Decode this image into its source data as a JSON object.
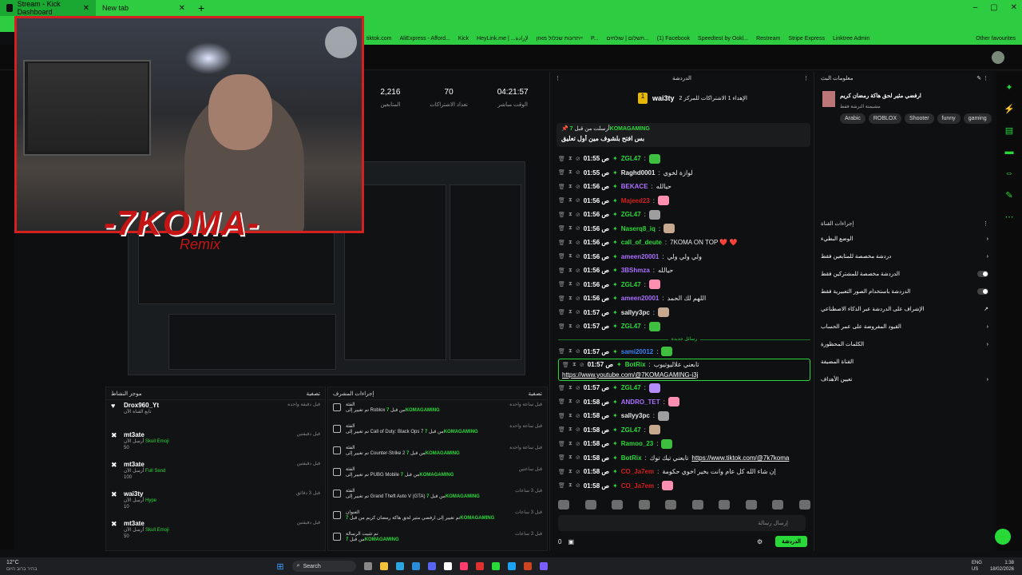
{
  "browser": {
    "tabs": [
      {
        "label": "Stream - Kick Dashboard",
        "active": true
      },
      {
        "label": "New tab",
        "active": false
      }
    ],
    "new_tab": "+",
    "controls": [
      "‒",
      "▢",
      "✕"
    ],
    "bookmarks": [
      "tiktok.com",
      "AliExpress - Afford...",
      "Kick",
      "HeyLink.me | ...لإرادة",
      "ייתרונות שכלול מאזן",
      "P...",
      "תשלום | שולחים...",
      "(1) Facebook",
      "Speedtest by Ookl...",
      "Restream",
      "Stripe Express",
      "Linktree Admin"
    ],
    "other_favourites": "Other favourites"
  },
  "brand": {
    "name": "7KOMA",
    "sub": "Remix"
  },
  "stats": [
    {
      "value": "2,216",
      "label": "المتابعين"
    },
    {
      "value": "70",
      "label": "تعداد الاشتراكات"
    },
    {
      "value": "04:21:57",
      "label": "الوقت مباشر"
    }
  ],
  "activity": {
    "title": "موجز النشاط",
    "filter": "تصفية",
    "events": [
      {
        "icon": "♥",
        "user": "Drox960_Yt",
        "action": "تابع القناة الآن",
        "amount": "",
        "time": "قبل دقيقة واحدة"
      },
      {
        "icon": "✖",
        "user": "mt3ate",
        "action": "Skull Emoji",
        "prefix": "أرسل الآن",
        "amount": "50",
        "time": "قبل دقيقتين"
      },
      {
        "icon": "✖",
        "user": "mt3ate",
        "action": "Full Send",
        "prefix": "أرسل الآن",
        "amount": "100",
        "time": "قبل دقيقتين"
      },
      {
        "icon": "✖",
        "user": "wai3ty",
        "action": "Hype",
        "prefix": "أرسل الآن",
        "amount": "10",
        "time": "قبل 3 دقائق"
      },
      {
        "icon": "✖",
        "user": "mt3ate",
        "action": "Skull Emoji",
        "prefix": "أرسل الآن",
        "amount": "50",
        "time": "قبل دقيقتين"
      },
      {
        "icon": "✖",
        "user": "mt3ate",
        "action": "",
        "amount": "",
        "time": ""
      }
    ]
  },
  "mod_actions": {
    "title": "إجراءات المشرف",
    "filter": "تصفية",
    "items": [
      {
        "type": "الفئة",
        "text": "تم تغيير إلى Roblox من قبل",
        "user": "7KOMAGAMING",
        "time": "قبل ساعة واحدة"
      },
      {
        "type": "الفئة",
        "text": "تم تغيير إلى Call of Duty: Black Ops 7 من قبل",
        "user": "7KOMAGAMING",
        "time": "قبل ساعة واحدة"
      },
      {
        "type": "الفئة",
        "text": "تم تغيير إلى Counter-Strike 2 من قبل",
        "user": "7KOMAGAMING",
        "time": "قبل ساعة واحدة"
      },
      {
        "type": "الفئة",
        "text": "تم تغيير إلى PUBG Mobile من قبل",
        "user": "7KOMAGAMING",
        "time": "قبل ساعتين"
      },
      {
        "type": "الفئة",
        "text": "تم تغيير إلى Grand Theft Auto V (GTA) من قبل",
        "user": "7KOMAGAMING",
        "time": "قبل 3 ساعات"
      },
      {
        "type": "العنوان",
        "text": "تم تغيير إلى ارفضي مثير لحق هاكة رمضان كريم من قبل",
        "user": "7KOMAGAMING",
        "time": "قبل 3 ساعات"
      },
      {
        "type": "تم تثبيت الرسالة",
        "text": "من قبل",
        "user": "7KOMAGAMING",
        "time": "قبل 3 ساعات"
      }
    ]
  },
  "chat": {
    "title": "الدردشة",
    "leader": {
      "rank": "1",
      "name": "wai3ty",
      "note": "الإهداء 1 الاشتراكات للمركز 2"
    },
    "pinned": {
      "by": "7KOMAGAMING",
      "label": "أرسلت من قبل",
      "message": "بس افتح بلشوف مين أول تعليق"
    },
    "separator": "رسائل جديدة",
    "messages": [
      {
        "time": "01:55 ص",
        "user": "ZGL47",
        "color": "#29d93a",
        "text": ""
      },
      {
        "time": "01:55 ص",
        "user": "Raghd0001",
        "color": "#e8e8e8",
        "text": "لوازة لخوي"
      },
      {
        "time": "01:56 ص",
        "user": "BEKACE",
        "color": "#a970ff",
        "text": "حيالله"
      },
      {
        "time": "01:56 ص",
        "user": "Majeed23",
        "color": "#d61f1f",
        "text": ""
      },
      {
        "time": "01:56 ص",
        "user": "ZGL47",
        "color": "#29d93a",
        "text": ""
      },
      {
        "time": "01:56 ص",
        "user": "Naserq8_iq",
        "color": "#29d93a",
        "text": ""
      },
      {
        "time": "01:56 ص",
        "user": "call_of_deute",
        "color": "#29d93a",
        "text": "7KOMA ON TOP ❤️ ❤️"
      },
      {
        "time": "01:56 ص",
        "user": "ameen20001",
        "color": "#a970ff",
        "text": "ولي ولي ولي"
      },
      {
        "time": "01:56 ص",
        "user": "3BShmza",
        "color": "#a970ff",
        "text": "حيالله"
      },
      {
        "time": "01:56 ص",
        "user": "ZGL47",
        "color": "#29d93a",
        "text": ""
      },
      {
        "time": "01:56 ص",
        "user": "ameen20001",
        "color": "#a970ff",
        "text": "اللهم لك الحمد"
      },
      {
        "time": "01:57 ص",
        "user": "sallyy3pc",
        "color": "#e8e8e8",
        "text": ""
      },
      {
        "time": "01:57 ص",
        "user": "ZGL47",
        "color": "#29d93a",
        "text": ""
      }
    ],
    "messages_after": [
      {
        "time": "01:57 ص",
        "user": "sami20012",
        "color": "#3b82f6",
        "text": ""
      },
      {
        "time": "01:57 ص",
        "user": "BotRix",
        "color": "#29d93a",
        "text": "تابعني علاليوتيوب",
        "link": "https://www.youtube.com/@7KOMAGAMING-i3j",
        "highlight": true
      },
      {
        "time": "01:57 ص",
        "user": "ZGL47",
        "color": "#29d93a",
        "text": ""
      },
      {
        "time": "01:58 ص",
        "user": "ANDRO_TET",
        "color": "#a970ff",
        "text": ""
      },
      {
        "time": "01:58 ص",
        "user": "sallyy3pc",
        "color": "#e8e8e8",
        "text": ""
      },
      {
        "time": "01:58 ص",
        "user": "ZGL47",
        "color": "#29d93a",
        "text": ""
      },
      {
        "time": "01:58 ص",
        "user": "Ramoo_23",
        "color": "#29d93a",
        "text": ""
      },
      {
        "time": "01:58 ص",
        "user": "BotRix",
        "color": "#29d93a",
        "text": "تابعني تيك توك",
        "link": "https://www.tiktok.com/@7k7koma"
      },
      {
        "time": "01:58 ص",
        "user": "CO_Ja7em",
        "color": "#d61f1f",
        "text": "إن شاء الله كل عام وانت بخير اخوي حكومة"
      },
      {
        "time": "01:58 ص",
        "user": "CO_Ja7em",
        "color": "#d61f1f",
        "text": ""
      }
    ],
    "input_placeholder": "إرسال رسالة",
    "send_label": "الدردشة",
    "count": "0"
  },
  "stream_info": {
    "title": "معلومات البث",
    "stream_title": "ارفضي مثير لحق هاكة رمضان كريم",
    "stream_sub": "مشيمتة النرشة فقط",
    "tags": [
      "Arabic",
      "ROBLOX",
      "Shooter",
      "funny",
      "gaming"
    ]
  },
  "channel_actions": {
    "title": "إجراءات القناة",
    "items": [
      {
        "label": "الوضع البطيء",
        "kind": "chevron"
      },
      {
        "label": "دردشة مخصصة للمتابعين فقط",
        "kind": "chevron"
      },
      {
        "label": "الدردشة مخصصة للمشتركين فقط",
        "kind": "toggle"
      },
      {
        "label": "الدردشة باستخدام الصور التعبيرية فقط",
        "kind": "toggle"
      },
      {
        "label": "الإشراف على الدردشة عبر الذكاء الاصطناعي",
        "kind": "link"
      },
      {
        "label": "القيود المفروضة على عمر الحساب",
        "kind": "chevron"
      },
      {
        "label": "الكلمات المحظورة",
        "kind": "chevron"
      },
      {
        "label": "القناة المضيفة",
        "kind": "none"
      },
      {
        "label": "تعيين الأهداف",
        "kind": "chevron"
      }
    ]
  },
  "taskbar": {
    "weather": "12°C",
    "weather_sub": "בהיר ברוב היום",
    "search": "Search",
    "lang": "ENG",
    "region": "US",
    "time": "1:38",
    "date": "18/02/2026"
  }
}
